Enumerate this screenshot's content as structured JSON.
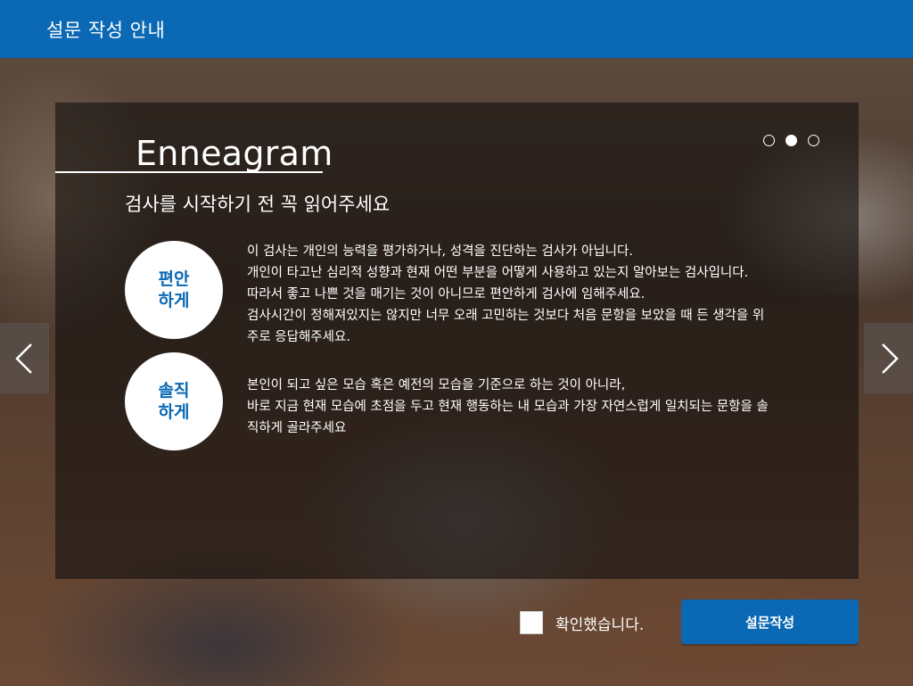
{
  "header": {
    "title": "설문 작성 안내"
  },
  "intro": {
    "brand": "Enneagram",
    "subtitle": "검사를 시작하기 전 꼭 읽어주세요",
    "pagination": {
      "count": 3,
      "active_index": 1
    }
  },
  "sections": [
    {
      "badge": [
        "편안",
        "하게"
      ],
      "lines": [
        "이 검사는 개인의 능력을 평가하거나, 성격을 진단하는 검사가 아닙니다.",
        "개인이 타고난 심리적 성향과 현재 어떤 부분을 어떻게 사용하고 있는지 알아보는 검사입니다.",
        "따라서 좋고 나쁜 것을 매기는 것이 아니므로 편안하게 검사에 임해주세요.",
        "검사시간이 정해져있지는 않지만 너무 오래 고민하는 것보다 처음 문항을 보았을 때 든 생각을 위",
        "주로 응답해주세요."
      ]
    },
    {
      "badge": [
        "솔직",
        "하게"
      ],
      "lines": [
        "본인이 되고 싶은 모습 혹은 예전의 모습을 기준으로 하는 것이 아니라,",
        "바로 지금 현재 모습에 초점을 두고 현재 행동하는 내 모습과 가장 자연스럽게 일치되는 문항을 솔",
        "직하게 골라주세요"
      ]
    }
  ],
  "nav": {
    "prev_icon": "chevron-left-icon",
    "next_icon": "chevron-right-icon"
  },
  "footer": {
    "confirm_label": "확인했습니다.",
    "confirm_checked": false,
    "submit_label": "설문작성"
  },
  "colors": {
    "primary": "#0a68b4",
    "white": "#ffffff"
  }
}
